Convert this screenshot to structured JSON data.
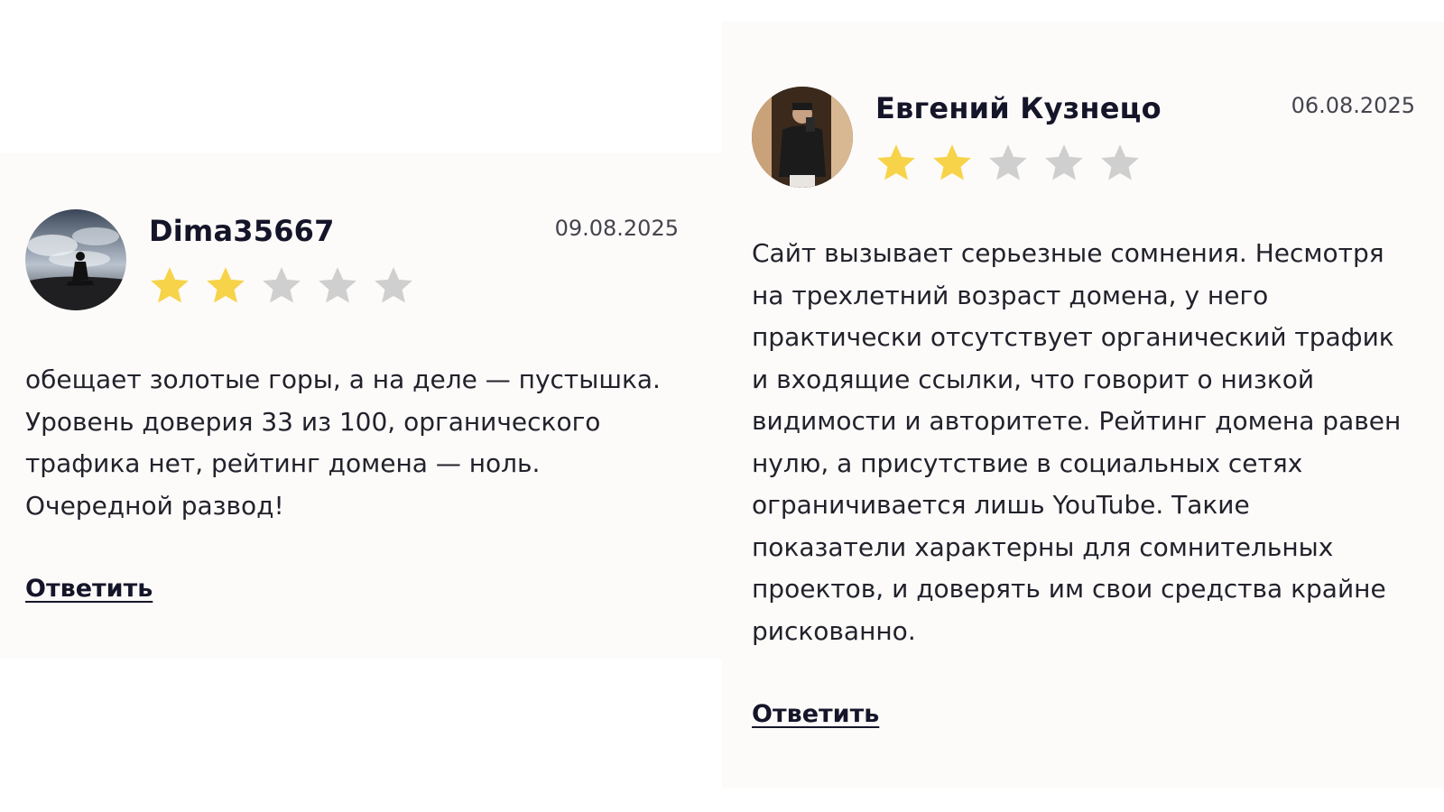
{
  "reviews": [
    {
      "author": "Dima35667",
      "date": "09.08.2025",
      "rating": 2,
      "max_rating": 5,
      "text": "обещает золотые горы, а на деле — пустышка. Уровень доверия 33 из 100, органического трафика нет, рейтинг домена — ноль. Очередной развод!",
      "reply_label": "Ответить",
      "avatar": "silhouette-sky-photo"
    },
    {
      "author": "Евгений Кузнецо",
      "date": "06.08.2025",
      "rating": 2,
      "max_rating": 5,
      "text": "Сайт вызывает серьезные сомнения. Несмотря на трехлетний возраст домена, у него практически отсутствует органический трафик и входящие ссылки, что говорит о низкой видимости и авторитете. Рейтинг домена равен нулю, а присутствие в социальных сетях ограничивается лишь YouTube. Такие показатели характерны для сомнительных проектов, и доверять им свои средства крайне рискованно.",
      "reply_label": "Ответить",
      "avatar": "mirror-selfie-photo"
    }
  ],
  "colors": {
    "star_filled": "#f7d34a",
    "star_empty": "#cfcfcf",
    "card_background": "#fdfbf9",
    "text": "#22222c"
  },
  "icons": {
    "star": "star-icon"
  }
}
